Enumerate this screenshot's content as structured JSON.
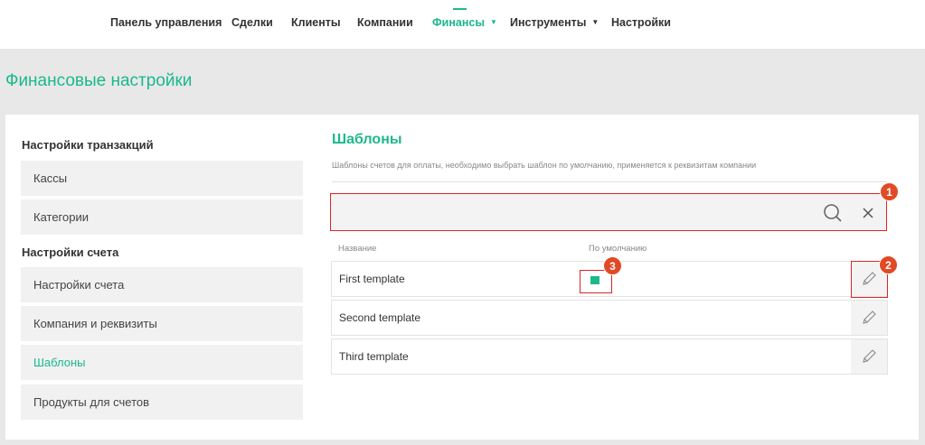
{
  "nav": {
    "items": [
      {
        "label": "Панель управления"
      },
      {
        "label": "Сделки"
      },
      {
        "label": "Клиенты"
      },
      {
        "label": "Компании"
      },
      {
        "label": "Финансы",
        "caret": "▼"
      },
      {
        "label": "Инструменты",
        "caret": "▼"
      },
      {
        "label": "Настройки"
      }
    ]
  },
  "page": {
    "title": "Финансовые настройки"
  },
  "sidebar": {
    "section1": "Настройки транзакций",
    "items1": [
      {
        "label": "Кассы"
      },
      {
        "label": "Категории"
      }
    ],
    "section2": "Настройки счета",
    "items2": [
      {
        "label": "Настройки счета"
      },
      {
        "label": "Компания и реквизиты"
      },
      {
        "label": "Шаблоны"
      },
      {
        "label": "Продукты для счетов"
      }
    ]
  },
  "content": {
    "title": "Шаблоны",
    "description": "Шаблоны счетов для оплаты, необходимо выбрать шаблон по умолчанию, применяется к реквизитам компании",
    "search": {
      "value": "",
      "placeholder": ""
    },
    "columns": {
      "name": "Название",
      "default": "По умолчанию"
    },
    "rows": [
      {
        "name": "First template",
        "is_default": true
      },
      {
        "name": "Second template",
        "is_default": false
      },
      {
        "name": "Third template",
        "is_default": false
      }
    ]
  },
  "annotations": [
    "1",
    "2",
    "3"
  ],
  "colors": {
    "accent": "#1bb88c",
    "highlight": "#d9252a",
    "badge": "#e14a26"
  },
  "icons": {
    "search": "search-icon",
    "clear": "close-icon",
    "edit": "pencil-icon"
  }
}
